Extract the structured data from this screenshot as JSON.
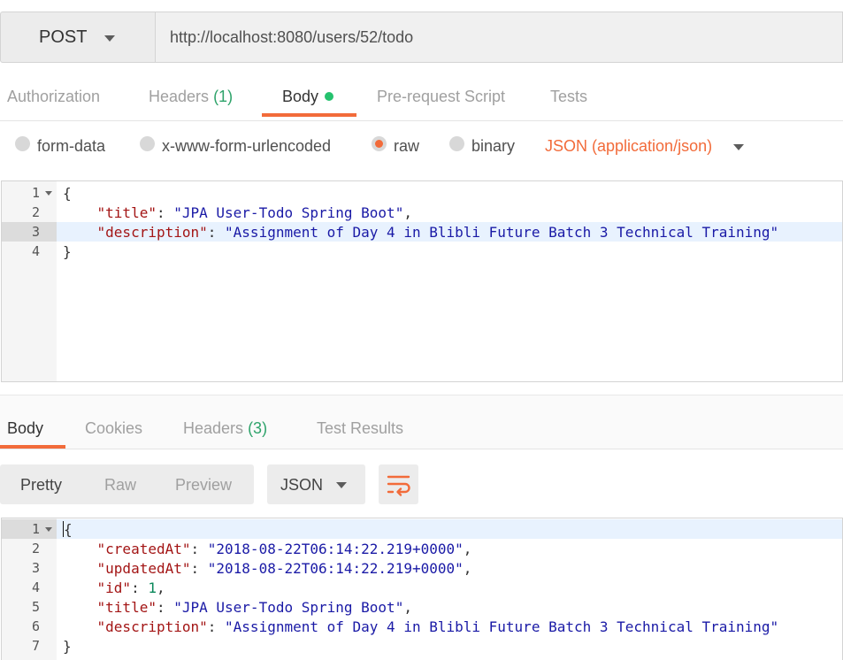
{
  "request": {
    "method": "POST",
    "url": "http://localhost:8080/users/52/todo"
  },
  "request_tabs": {
    "authorization": "Authorization",
    "headers": "Headers",
    "headers_count": "(1)",
    "body": "Body",
    "pre_request": "Pre-request Script",
    "tests": "Tests"
  },
  "body_types": {
    "form_data": "form-data",
    "urlencoded": "x-www-form-urlencoded",
    "raw": "raw",
    "binary": "binary",
    "selected": "raw",
    "content_type": "JSON (application/json)"
  },
  "request_body": {
    "line_numbers": [
      "1",
      "2",
      "3",
      "4"
    ],
    "open_brace": "{",
    "close_brace": "}",
    "title_key": "\"title\"",
    "title_value": "\"JPA User-Todo Spring Boot\"",
    "description_key": "\"description\"",
    "description_value": "\"Assignment of Day 4 in Blibli Future Batch 3 Technical Training\""
  },
  "response_tabs": {
    "body": "Body",
    "cookies": "Cookies",
    "headers": "Headers",
    "headers_count": "(3)",
    "test_results": "Test Results"
  },
  "response_toolbar": {
    "pretty": "Pretty",
    "raw": "Raw",
    "preview": "Preview",
    "format": "JSON",
    "wrap_icon": "wrap-lines-icon"
  },
  "response_body": {
    "line_numbers": [
      "1",
      "2",
      "3",
      "4",
      "5",
      "6",
      "7"
    ],
    "open_brace": "{",
    "close_brace": "}",
    "created_key": "\"createdAt\"",
    "created_value": "\"2018-08-22T06:14:22.219+0000\"",
    "updated_key": "\"updatedAt\"",
    "updated_value": "\"2018-08-22T06:14:22.219+0000\"",
    "id_key": "\"id\"",
    "id_value": "1",
    "title_key": "\"title\"",
    "title_value": "\"JPA User-Todo Spring Boot\"",
    "description_key": "\"description\"",
    "description_value": "\"Assignment of Day 4 in Blibli Future Batch 3 Technical Training\""
  },
  "colors": {
    "accent": "#f26b3a",
    "count_green": "#2fa36b",
    "dot_green": "#25c26e"
  }
}
